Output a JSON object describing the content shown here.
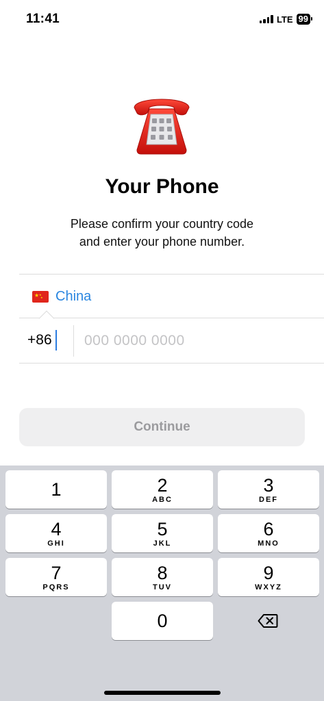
{
  "status_bar": {
    "time": "11:41",
    "network": "LTE",
    "battery": "99"
  },
  "title": "Your Phone",
  "subtitle_line1": "Please confirm your country code",
  "subtitle_line2": "and enter your phone number.",
  "country": {
    "name": "China",
    "flag_icon": "china-flag-icon"
  },
  "phone": {
    "code": "+86",
    "placeholder": "000 0000 0000",
    "value": ""
  },
  "continue_label": "Continue",
  "colors": {
    "accent": "#2a86e0",
    "continue_bg": "#efeff0",
    "continue_text": "#9b9b9e",
    "keypad_bg": "#d1d3d9"
  },
  "keypad": {
    "keys": [
      {
        "num": "1",
        "letters": ""
      },
      {
        "num": "2",
        "letters": "ABC"
      },
      {
        "num": "3",
        "letters": "DEF"
      },
      {
        "num": "4",
        "letters": "GHI"
      },
      {
        "num": "5",
        "letters": "JKL"
      },
      {
        "num": "6",
        "letters": "MNO"
      },
      {
        "num": "7",
        "letters": "PQRS"
      },
      {
        "num": "8",
        "letters": "TUV"
      },
      {
        "num": "9",
        "letters": "WXYZ"
      },
      {
        "num": "0",
        "letters": ""
      }
    ],
    "backspace_icon": "backspace-icon"
  }
}
